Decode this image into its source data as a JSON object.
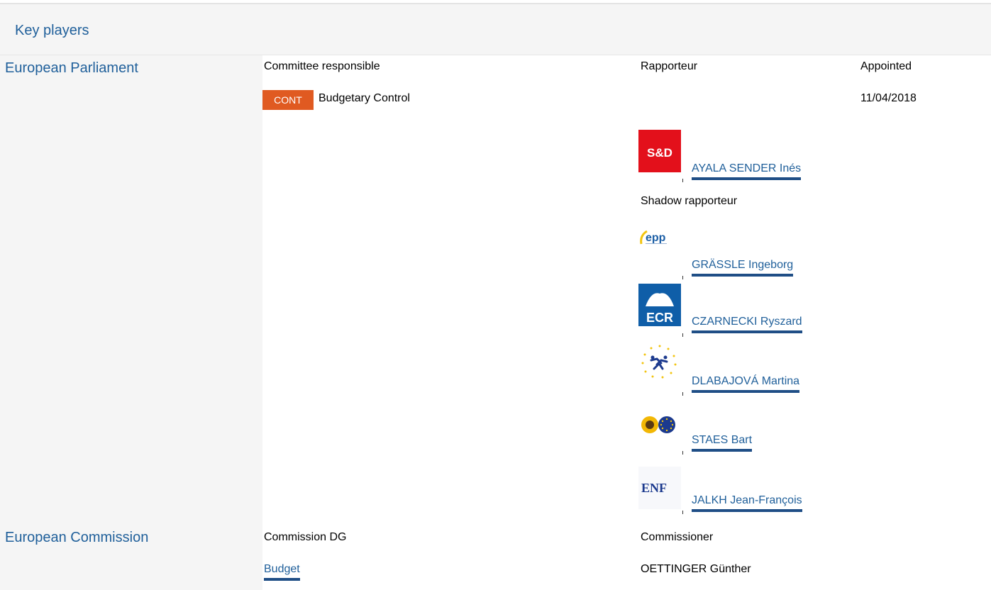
{
  "header": {
    "title": "Key players"
  },
  "parliament": {
    "label": "European Parliament",
    "col_committee": "Committee responsible",
    "col_rapporteur": "Rapporteur",
    "col_appointed": "Appointed",
    "committee_code": "CONT",
    "committee_name": "Budgetary Control",
    "appointed_date": "11/04/2018",
    "rapporteur": {
      "group_logo": "S&D",
      "name": "AYALA SENDER Inés"
    },
    "shadow_label": "Shadow rapporteur",
    "shadows": [
      {
        "group_logo": "epp",
        "name": "GRÄSSLE Ingeborg"
      },
      {
        "group_logo": "ECR",
        "name": "CZARNECKI Ryszard"
      },
      {
        "group_logo": "ALDE",
        "name": "DLABAJOVÁ Martina"
      },
      {
        "group_logo": "Greens/EFA",
        "name": "STAES Bart"
      },
      {
        "group_logo": "ENF",
        "name": "JALKH Jean-François"
      }
    ]
  },
  "commission": {
    "label": "European Commission",
    "col_dg": "Commission DG",
    "col_commissioner": "Commissioner",
    "dg": "Budget",
    "commissioner": "OETTINGER Günther"
  },
  "colors": {
    "link": "#1f5f9a",
    "cont_badge": "#e05a21",
    "sd_red": "#e3101b",
    "ecr_blue": "#0f5ea8",
    "header_bg": "#f5f5f5"
  }
}
